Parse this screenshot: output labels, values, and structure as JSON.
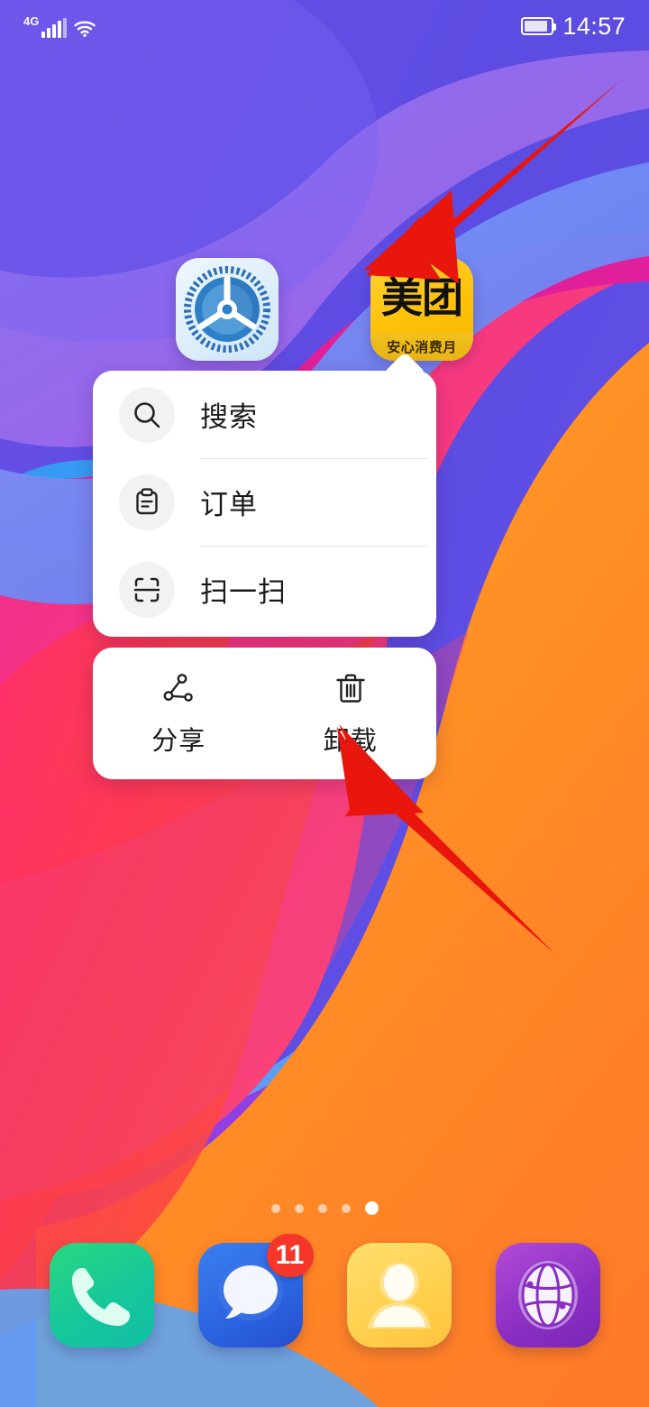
{
  "status_bar": {
    "network_type": "4G",
    "signal_icon": "signal-bars-icon",
    "wifi_icon": "wifi-icon",
    "battery_icon": "battery-icon",
    "time": "14:57"
  },
  "home_screen": {
    "apps": [
      {
        "name": "settings",
        "label": "设置",
        "icon": "settings-gear-icon"
      },
      {
        "name": "meituan",
        "label": "",
        "icon": "meituan-icon",
        "icon_text": "美团",
        "banner_text": "安心消费月"
      }
    ],
    "page_indicator": {
      "total": 5,
      "active_index": 4
    }
  },
  "shortcut_menu": {
    "items": [
      {
        "label": "搜索",
        "icon": "search-icon"
      },
      {
        "label": "订单",
        "icon": "clipboard-icon"
      },
      {
        "label": "扫一扫",
        "icon": "scan-icon"
      }
    ],
    "actions": [
      {
        "label": "分享",
        "icon": "share-icon"
      },
      {
        "label": "卸载",
        "icon": "trash-icon"
      }
    ]
  },
  "dock": {
    "apps": [
      {
        "name": "phone",
        "icon": "phone-icon",
        "badge": ""
      },
      {
        "name": "messages",
        "icon": "message-bubble-icon",
        "badge": "11"
      },
      {
        "name": "contacts",
        "icon": "contacts-person-icon",
        "badge": ""
      },
      {
        "name": "browser",
        "icon": "browser-globe-icon",
        "badge": ""
      }
    ]
  },
  "annotations": {
    "arrow_color": "#e8160c",
    "arrows": [
      {
        "name": "arrow-to-meituan-icon",
        "from": [
          688,
          90
        ],
        "to": [
          424,
          302
        ]
      },
      {
        "name": "arrow-to-uninstall",
        "from": [
          614,
          1054
        ],
        "to": [
          378,
          806
        ]
      }
    ]
  },
  "colors": {
    "wallpaper_top": "#5b4de0",
    "wallpaper_blue": "#6f8bf2",
    "wallpaper_magenta": "#ef1f8e",
    "wallpaper_orange": "#ff8a1f",
    "wallpaper_red": "#f5303c",
    "wallpaper_purple": "#9b3ce8",
    "accent_red": "#e8160c",
    "badge_red": "#f5372b"
  }
}
